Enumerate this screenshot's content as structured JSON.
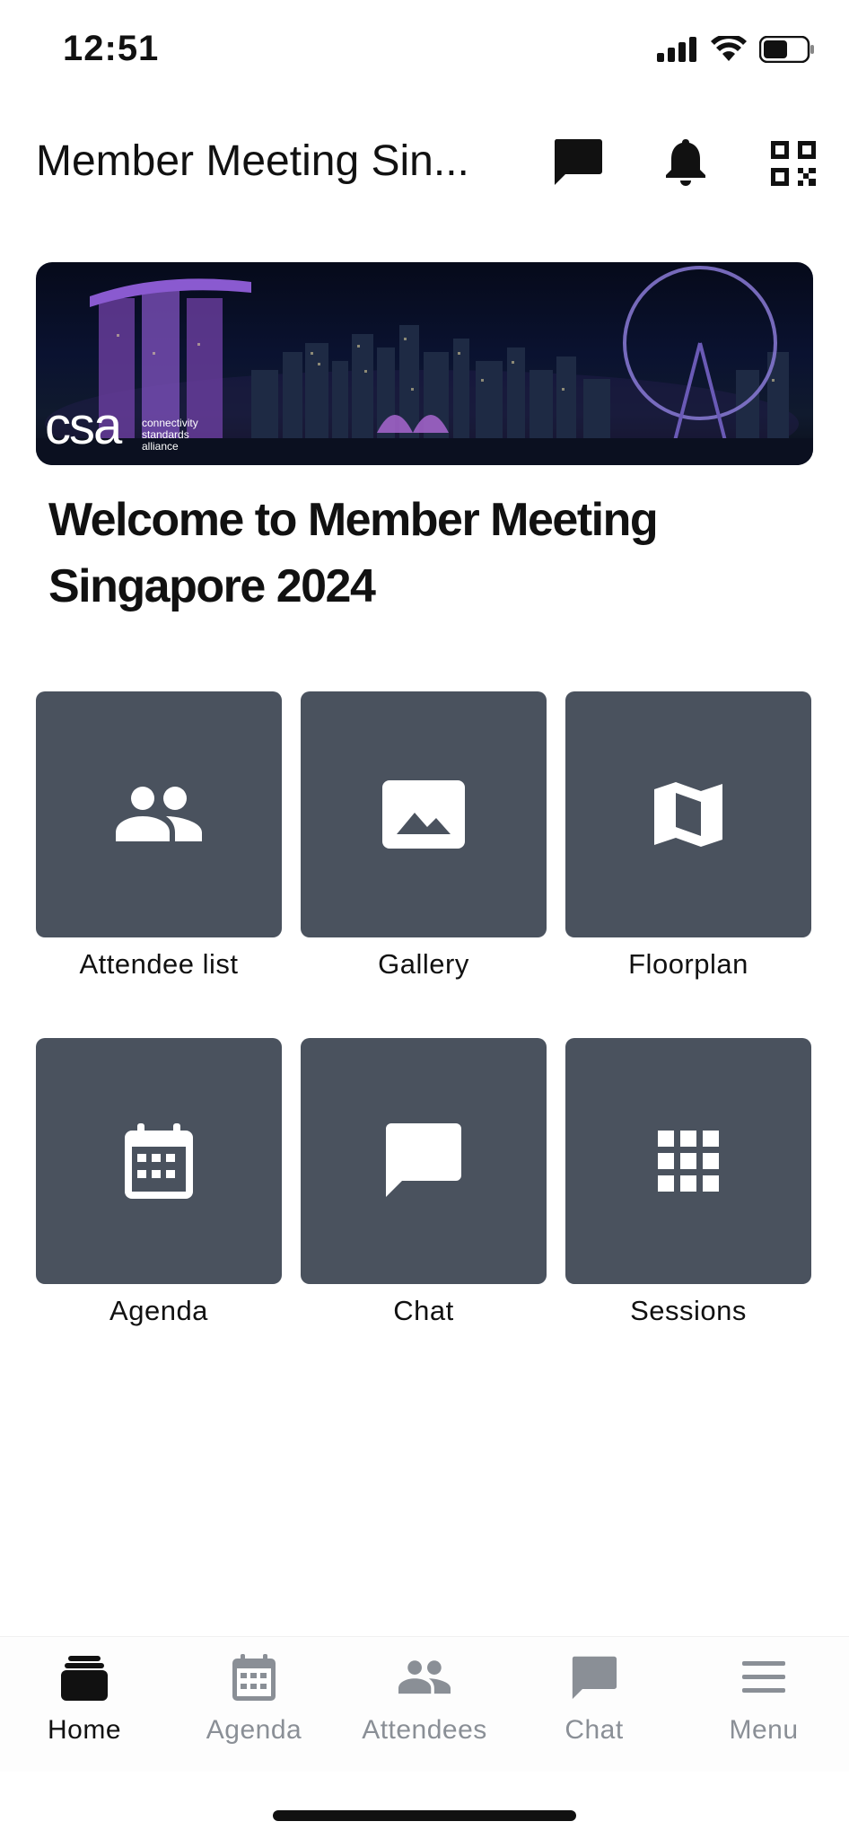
{
  "status_bar": {
    "time": "12:51"
  },
  "header": {
    "title": "Member Meeting Sin...",
    "icons": [
      "chat-icon",
      "bell-icon",
      "qr-code-icon"
    ]
  },
  "banner": {
    "logo_text": "csa",
    "logo_sub": [
      "connectivity",
      "standards",
      "alliance"
    ]
  },
  "welcome": {
    "text": "Welcome to Member Meeting Singapore 2024"
  },
  "tiles": [
    {
      "label": "Attendee list",
      "icon": "people-icon"
    },
    {
      "label": "Gallery",
      "icon": "image-icon"
    },
    {
      "label": "Floorplan",
      "icon": "map-icon"
    },
    {
      "label": "Agenda",
      "icon": "calendar-icon"
    },
    {
      "label": "Chat",
      "icon": "chat-bubble-icon"
    },
    {
      "label": "Sessions",
      "icon": "grid-icon"
    }
  ],
  "bottom_nav": {
    "items": [
      {
        "label": "Home",
        "icon": "home-icon",
        "active": true
      },
      {
        "label": "Agenda",
        "icon": "calendar-icon",
        "active": false
      },
      {
        "label": "Attendees",
        "icon": "people-icon",
        "active": false
      },
      {
        "label": "Chat",
        "icon": "chat-icon",
        "active": false
      },
      {
        "label": "Menu",
        "icon": "menu-icon",
        "active": false
      }
    ]
  },
  "colors": {
    "tile_bg": "#4a525e",
    "nav_active": "#111111",
    "nav_inactive": "#8a8f96"
  }
}
